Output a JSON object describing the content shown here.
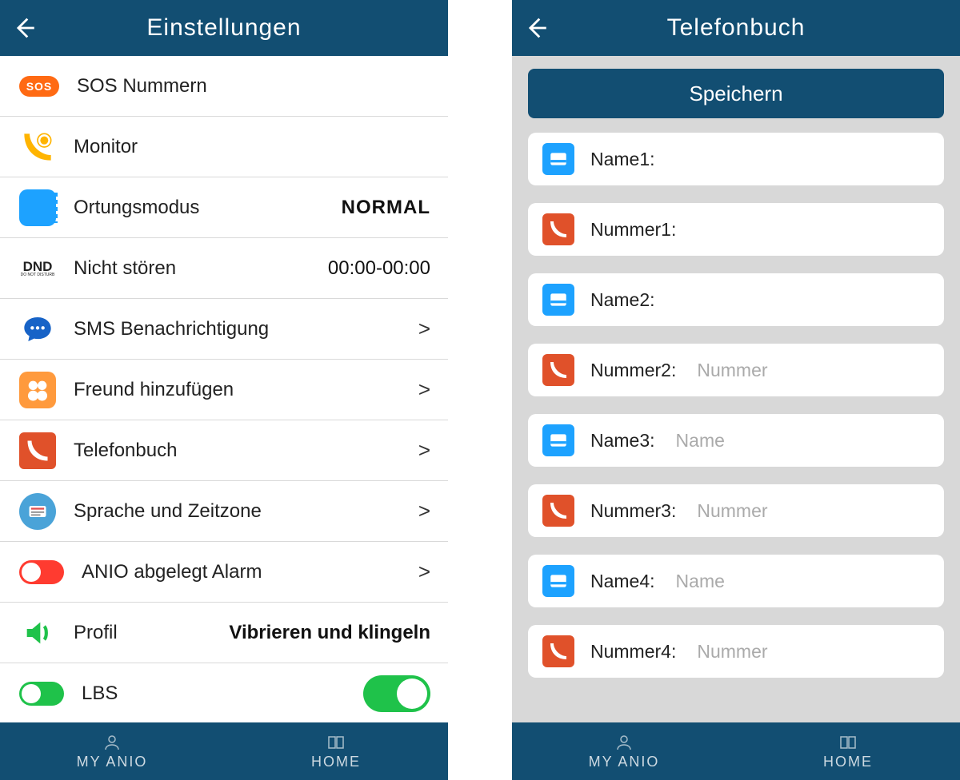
{
  "left": {
    "title": "Einstellungen",
    "rows": {
      "sos": {
        "label": "SOS Nummern"
      },
      "monitor": {
        "label": "Monitor"
      },
      "location": {
        "label": "Ortungsmodus",
        "value": "NORMAL"
      },
      "dnd": {
        "icon": "DND",
        "icon_sub": "DO NOT DISTURB",
        "label": "Nicht stören",
        "value": "00:00-00:00"
      },
      "sms": {
        "label": "SMS Benachrichtigung",
        "chevron": ">"
      },
      "friend": {
        "label": "Freund hinzufügen",
        "chevron": ">"
      },
      "phonebook": {
        "label": "Telefonbuch",
        "chevron": ">"
      },
      "lang": {
        "label": "Sprache und Zeitzone",
        "chevron": ">"
      },
      "alarm": {
        "label": "ANIO abgelegt Alarm",
        "chevron": ">"
      },
      "profil": {
        "label": "Profil",
        "value": "Vibrieren und klingeln"
      },
      "lbs": {
        "label": "LBS"
      }
    }
  },
  "right": {
    "title": "Telefonbuch",
    "save": "Speichern",
    "entries": [
      {
        "type": "name",
        "label": "Name1:",
        "placeholder": ""
      },
      {
        "type": "num",
        "label": "Nummer1:",
        "placeholder": ""
      },
      {
        "type": "name",
        "label": "Name2:",
        "placeholder": ""
      },
      {
        "type": "num",
        "label": "Nummer2:",
        "placeholder": "Nummer"
      },
      {
        "type": "name",
        "label": "Name3:",
        "placeholder": "Name"
      },
      {
        "type": "num",
        "label": "Nummer3:",
        "placeholder": "Nummer"
      },
      {
        "type": "name",
        "label": "Name4:",
        "placeholder": "Name"
      },
      {
        "type": "num",
        "label": "Nummer4:",
        "placeholder": "Nummer"
      }
    ]
  },
  "nav": {
    "myanio": "MY ANIO",
    "home": "HOME"
  },
  "icons": {
    "sos_text": "SOS"
  }
}
